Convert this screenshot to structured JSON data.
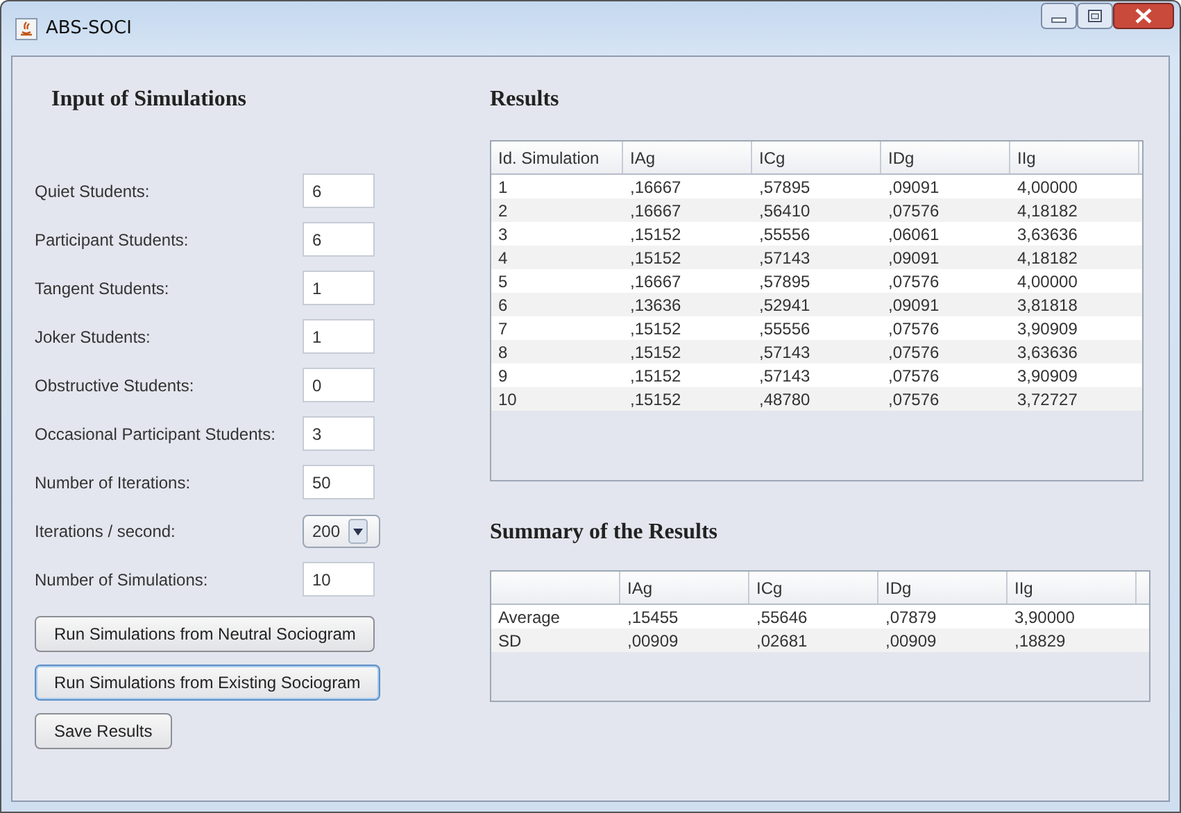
{
  "window": {
    "title": "ABS-SOCI"
  },
  "input": {
    "title": "Input of Simulations",
    "fields": [
      {
        "label": "Quiet Students:",
        "value": "6",
        "kind": "text"
      },
      {
        "label": "Participant Students:",
        "value": "6",
        "kind": "text"
      },
      {
        "label": "Tangent Students:",
        "value": "1",
        "kind": "text"
      },
      {
        "label": "Joker Students:",
        "value": "1",
        "kind": "text"
      },
      {
        "label": "Obstructive Students:",
        "value": "0",
        "kind": "text"
      },
      {
        "label": "Occasional Participant Students:",
        "value": "3",
        "kind": "text"
      },
      {
        "label": "Number of Iterations:",
        "value": "50",
        "kind": "text"
      },
      {
        "label": "Iterations / second:",
        "value": "200",
        "kind": "dropdown"
      },
      {
        "label": "Number of Simulations:",
        "value": "10",
        "kind": "text"
      }
    ],
    "buttons": [
      {
        "label": "Run Simulations from Neutral Sociogram",
        "focused": false
      },
      {
        "label": "Run Simulations from Existing Sociogram",
        "focused": true
      },
      {
        "label": "Save Results",
        "focused": false
      }
    ]
  },
  "results": {
    "title": "Results",
    "columns": [
      "Id. Simulation",
      "IAg",
      "ICg",
      "IDg",
      "IIg"
    ],
    "rows": [
      [
        "1",
        ",16667",
        ",57895",
        ",09091",
        "4,00000"
      ],
      [
        "2",
        ",16667",
        ",56410",
        ",07576",
        "4,18182"
      ],
      [
        "3",
        ",15152",
        ",55556",
        ",06061",
        "3,63636"
      ],
      [
        "4",
        ",15152",
        ",57143",
        ",09091",
        "4,18182"
      ],
      [
        "5",
        ",16667",
        ",57895",
        ",07576",
        "4,00000"
      ],
      [
        "6",
        ",13636",
        ",52941",
        ",09091",
        "3,81818"
      ],
      [
        "7",
        ",15152",
        ",55556",
        ",07576",
        "3,90909"
      ],
      [
        "8",
        ",15152",
        ",57143",
        ",07576",
        "3,63636"
      ],
      [
        "9",
        ",15152",
        ",57143",
        ",07576",
        "3,90909"
      ],
      [
        "10",
        ",15152",
        ",48780",
        ",07576",
        "3,72727"
      ]
    ]
  },
  "summary": {
    "title": "Summary of the Results",
    "columns": [
      "",
      "IAg",
      "ICg",
      "IDg",
      "IIg"
    ],
    "rows": [
      [
        "Average",
        ",15455",
        ",55646",
        ",07879",
        "3,90000"
      ],
      [
        "SD",
        ",00909",
        ",02681",
        ",00909",
        ",18829"
      ]
    ]
  }
}
